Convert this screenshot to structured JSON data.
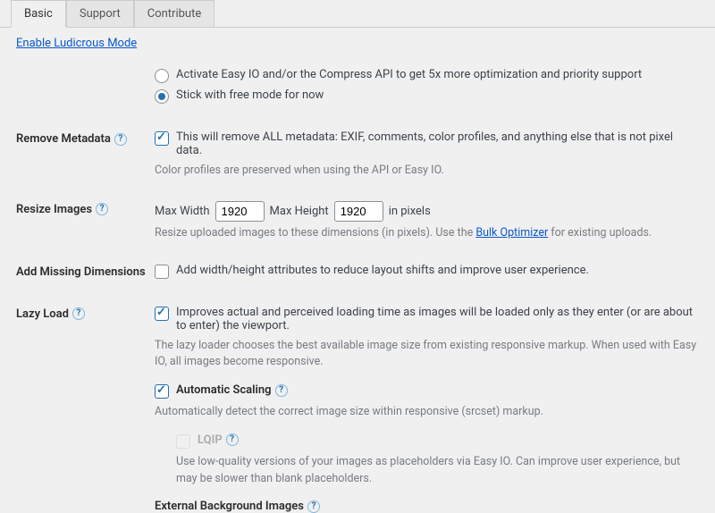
{
  "tabs": {
    "basic": "Basic",
    "support": "Support",
    "contribute": "Contribute"
  },
  "ludicrous_link": "Enable Ludicrous Mode",
  "mode": {
    "activate": "Activate Easy IO and/or the Compress API to get 5x more optimization and priority support",
    "stick": "Stick with free mode for now"
  },
  "remove_metadata": {
    "label": "Remove Metadata",
    "opt": "This will remove ALL metadata: EXIF, comments, color profiles, and anything else that is not pixel data.",
    "desc": "Color profiles are preserved when using the API or Easy IO."
  },
  "resize": {
    "label": "Resize Images",
    "max_width_label": "Max Width",
    "max_width": "1920",
    "max_height_label": "Max Height",
    "max_height": "1920",
    "units": "in pixels",
    "desc1": "Resize uploaded images to these dimensions (in pixels). Use the ",
    "bulk_link": "Bulk Optimizer",
    "desc2": " for existing uploads."
  },
  "add_dims": {
    "label": "Add Missing Dimensions",
    "opt": "Add width/height attributes to reduce layout shifts and improve user experience."
  },
  "lazy": {
    "label": "Lazy Load",
    "opt": "Improves actual and perceived loading time as images will be loaded only as they enter (or are about to enter) the viewport.",
    "desc": "The lazy loader chooses the best available image size from existing responsive markup. When used with Easy IO, all images become responsive.",
    "auto_label": "Automatic Scaling",
    "auto_desc": "Automatically detect the correct image size within responsive (srcset) markup.",
    "lqip_label": "LQIP",
    "lqip_desc": "Use low-quality versions of your images as placeholders via Easy IO. Can improve user experience, but may be slower than blank placeholders.",
    "ext_bg": "External Background Images"
  }
}
